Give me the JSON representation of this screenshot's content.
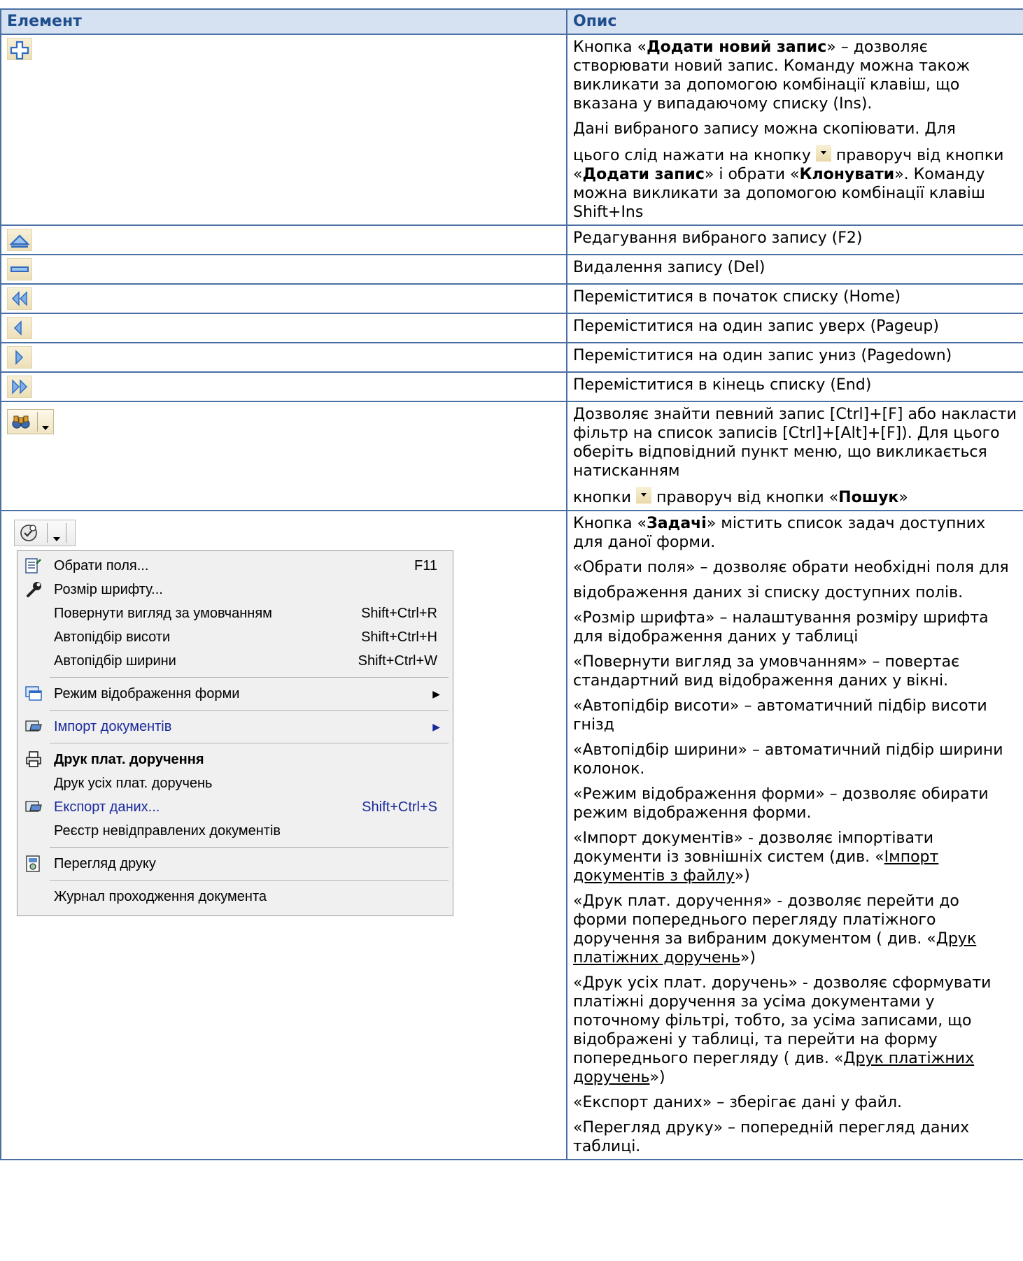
{
  "header": {
    "col1": "Елемент",
    "col2": "Опис"
  },
  "rows": [
    {
      "icon": "plus-icon",
      "desc": [
        {
          "parts": [
            {
              "t": "Кнопка «"
            },
            {
              "t": "Додати новий запис",
              "b": true
            },
            {
              "t": "» – дозволяє створювати новий запис. Команду можна також викликати за допомогою комбінації клавіш, що вказана у випадаючому списку (Ins)."
            }
          ]
        },
        {
          "parts": [
            {
              "t": "Дані вибраного запису можна скопіювати. Для"
            }
          ]
        },
        {
          "parts": [
            {
              "t": "цього слід нажати на кнопку "
            },
            {
              "dd": true
            },
            {
              "t": " праворуч від кнопки «"
            },
            {
              "t": "Додати запис",
              "b": true
            },
            {
              "t": "» і обрати «"
            },
            {
              "t": "Клонувати",
              "b": true
            },
            {
              "t": "». Команду можна викликати за допомогою комбінації клавіш Shift+Ins"
            }
          ]
        }
      ]
    },
    {
      "icon": "edit-icon",
      "desc": [
        {
          "parts": [
            {
              "t": "Редагування вибраного запису (F2)"
            }
          ]
        }
      ]
    },
    {
      "icon": "minus-icon",
      "desc": [
        {
          "parts": [
            {
              "t": "Видалення запису (Del)"
            }
          ]
        }
      ]
    },
    {
      "icon": "first-record-icon",
      "desc": [
        {
          "parts": [
            {
              "t": "Переміститися в початок списку (Home)"
            }
          ]
        }
      ]
    },
    {
      "icon": "prev-record-icon",
      "desc": [
        {
          "parts": [
            {
              "t": "Переміститися на один запис уверх (Pageup)"
            }
          ]
        }
      ]
    },
    {
      "icon": "next-record-icon",
      "desc": [
        {
          "parts": [
            {
              "t": "Переміститися на один запис униз (Pagedown)"
            }
          ]
        }
      ]
    },
    {
      "icon": "last-record-icon",
      "desc": [
        {
          "parts": [
            {
              "t": "Переміститися в кінець списку (End)"
            }
          ]
        }
      ]
    },
    {
      "icon": "search",
      "search_label": "Пошук",
      "desc": [
        {
          "parts": [
            {
              "t": "Дозволяє знайти певний запис [Ctrl]+[F] або накласти фільтр на список записів [Ctrl]+[Alt]+[F]). Для цього оберіть відповідний пункт меню, що викликається натисканням"
            }
          ]
        },
        {
          "parts": [
            {
              "t": "кнопки "
            },
            {
              "dd": true
            },
            {
              "t": " праворуч від кнопки «"
            },
            {
              "t": "Пошук",
              "b": true
            },
            {
              "t": "»"
            }
          ]
        }
      ]
    },
    {
      "icon": "tasks",
      "desc": [
        {
          "parts": [
            {
              "t": "Кнопка «"
            },
            {
              "t": "Задачі",
              "b": true
            },
            {
              "t": "» містить список задач доступних для даної форми."
            }
          ]
        },
        {
          "parts": [
            {
              "t": "«Обрати поля» – дозволяє обрати необхідні поля для"
            }
          ]
        },
        {
          "parts": [
            {
              "t": "відображення даних зі списку доступних полів."
            }
          ]
        },
        {
          "parts": [
            {
              "t": "«Розмір шрифта» – налаштування розміру шрифта для відображення даних у таблиці"
            }
          ]
        },
        {
          "parts": [
            {
              "t": "«Повернути вигляд за умовчанням» – повертає стандартний вид відображення даних у вікні."
            }
          ]
        },
        {
          "parts": [
            {
              "t": "«Автопідбір висоти» – автоматичний підбір висоти гнізд"
            }
          ]
        },
        {
          "parts": [
            {
              "t": "«Автопідбір ширини» – автоматичний підбір ширини колонок."
            }
          ]
        },
        {
          "parts": [
            {
              "t": "«Режим відображення форми» – дозволяє обирати режим відображення форми."
            }
          ]
        },
        {
          "parts": [
            {
              "t": "«Імпорт документів» - дозволяє імпортівати документи із зовнішніх систем (див. «"
            },
            {
              "t": "Імпорт документів з файлу",
              "u": true
            },
            {
              "t": "»)"
            }
          ]
        },
        {
          "parts": [
            {
              "t": "«Друк плат. доручення» - дозволяє перейти до форми попереднього перегляду платіжного доручення за вибраним документом ( див. «"
            },
            {
              "t": "Друк платіжних доручень",
              "u": true
            },
            {
              "t": "»)"
            }
          ]
        },
        {
          "parts": [
            {
              "t": "«Друк усіх плат. доручень» - дозволяє сформувати платіжні доручення за усіма документами у поточному фільтрі, тобто, за усіма записами, що відображені у таблиці, та перейти на форму попереднього перегляду ( див. «"
            },
            {
              "t": "Друк платіжних доручень",
              "u": true
            },
            {
              "t": "»)"
            }
          ]
        },
        {
          "parts": [
            {
              "t": "«Експорт даних» – зберігає дані у файл."
            }
          ]
        },
        {
          "parts": [
            {
              "t": "«Перегляд друку» – попередній перегляд даних таблиці."
            }
          ]
        }
      ]
    }
  ],
  "tasks_panel": {
    "button_label": "Задачі",
    "menu": [
      {
        "label": "Обрати поля...",
        "shortcut": "F11",
        "icon": "select-fields-icon"
      },
      {
        "label": "Розмір шрифту...",
        "shortcut": "",
        "icon": "wrench-icon"
      },
      {
        "label": "Повернути вигляд за умовчанням",
        "shortcut": "Shift+Ctrl+R"
      },
      {
        "label": "Автопідбір висоти",
        "shortcut": "Shift+Ctrl+H"
      },
      {
        "label": "Автопідбір ширини",
        "shortcut": "Shift+Ctrl+W"
      },
      {
        "sep": true
      },
      {
        "label": "Режим відображення форми",
        "submenu": true,
        "icon": "form-mode-icon"
      },
      {
        "sep": true
      },
      {
        "label": "Імпорт документів",
        "submenu": true,
        "icon": "import-icon",
        "style": "blue"
      },
      {
        "sep": true
      },
      {
        "label": "Друк плат. доручення",
        "icon": "printer-icon",
        "style": "bold"
      },
      {
        "label": "Друк усіх плат. доручень"
      },
      {
        "label": "Експорт даних...",
        "shortcut": "Shift+Ctrl+S",
        "icon": "export-icon",
        "style": "blue"
      },
      {
        "label": "Реєстр невідправлених документів"
      },
      {
        "sep": true
      },
      {
        "label": "Перегляд друку",
        "icon": "print-preview-icon"
      },
      {
        "sep": true
      },
      {
        "label": "Журнал проходження документа"
      }
    ]
  },
  "colors": {
    "border": "#4a6fa3",
    "header_bg": "#d6e2f2",
    "header_text": "#1f4e8c",
    "icon_blue": "#2e6cc4"
  }
}
